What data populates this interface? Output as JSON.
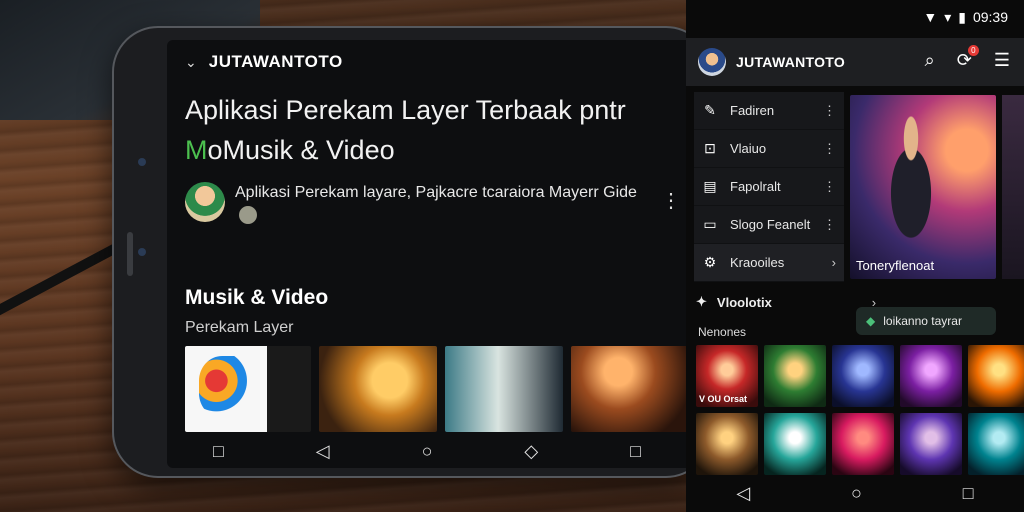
{
  "landscape": {
    "brand": "JUTAWANTOTO",
    "title_accent": "M",
    "title_line1": "Aplikasi Perekam Layer Terbaak pntr",
    "title_line2_rest": "oMusik & Video",
    "channel_text": "Aplikasi Perekam layare, Pajkacre tcaraiora Mayerr Gide",
    "section_title": "Musik & Video",
    "section_sub": "Perekam Layer",
    "icons": {
      "collapse": "chevron-down-icon",
      "more": "more-vert-icon",
      "coin": "coin-icon"
    },
    "nav": [
      "□",
      "◁",
      "○",
      "◇",
      "□"
    ]
  },
  "portrait": {
    "status": {
      "time": "09:39",
      "signal": "▾",
      "battery": "▮"
    },
    "brand": "JUTAWANTOTO",
    "notif_count": "0",
    "menu": [
      {
        "label": "Fadiren",
        "icon": "✎",
        "trail": "⋮"
      },
      {
        "label": "Vlaiuo",
        "icon": "⊡",
        "trail": "⋮"
      },
      {
        "label": "Fapolralt",
        "icon": "▤",
        "trail": "⋮"
      },
      {
        "label": "Slogo Feanelt",
        "icon": "▭",
        "trail": "⋮"
      },
      {
        "label": "Kraooiles",
        "icon": "⚙",
        "trail": "›"
      }
    ],
    "hero_title": "Toneryflenoat",
    "section": {
      "label": "Vloolotix",
      "icon": "✦",
      "trail": "›"
    },
    "chip": "loikanno tayrar",
    "caption": "Nenones",
    "grid_captions": [
      "V OU Orsat",
      "",
      "",
      "",
      "",
      "",
      "",
      "",
      "",
      ""
    ],
    "nav": [
      "◁",
      "○",
      "□"
    ]
  }
}
